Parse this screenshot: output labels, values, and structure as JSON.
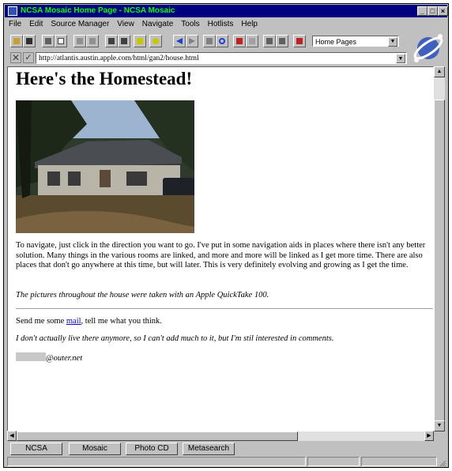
{
  "window": {
    "title": "NCSA Mosaic Home Page - NCSA Mosaic",
    "controls": [
      "minimize-icon",
      "maximize-icon",
      "close-icon"
    ]
  },
  "menu": [
    "File",
    "Edit",
    "Source Manager",
    "View",
    "Navigate",
    "Tools",
    "Hotlists",
    "Help"
  ],
  "toolbar": {
    "icons": [
      "open-folder-icon",
      "save-disk-icon",
      "print-icon",
      "print-preview-icon",
      "cut-icon",
      "copy-icon",
      "find-icon",
      "find-next-icon",
      "document-icon",
      "help-icon",
      "back-arrow-icon",
      "forward-arrow-icon",
      "stop-icon",
      "reload-icon",
      "home-icon",
      "cancel-icon",
      "mail-icon",
      "news-icon",
      "add-hotlist-icon"
    ],
    "hotlist_value": "Home Pages"
  },
  "address": {
    "url": "http://atlantis.austin.apple.com/html/gan2/house.html"
  },
  "page": {
    "heading": "Here's the Homestead!",
    "photo_alt": "house-photo",
    "para1": "To navigate, just click in the direction you want to go. I've put in some navigation aids in places where there isn't any better solution. Many things in the various rooms are linked, and more and more will be linked as I get more time. There are also places that don't go anywhere at this time, but will later. This is very definitely evolving and growing as I get the time.",
    "para2": "The pictures throughout the house were taken with an Apple QuickTake 100.",
    "mail_before": "Send me some ",
    "mail_link": "mail",
    "mail_after": ", tell me what you think.",
    "para4": "I don't actually live there anymore, so I can't add much to it, but I'm stil interested in comments.",
    "email_domain": "@outer.net"
  },
  "tabs": [
    "NCSA",
    "Mosaic",
    "Photo CD",
    "Metasearch"
  ],
  "colors": {
    "titlebar": "#000080",
    "title_text": "#00ff00",
    "chrome": "#c0c0c0",
    "link": "#0000cc"
  }
}
